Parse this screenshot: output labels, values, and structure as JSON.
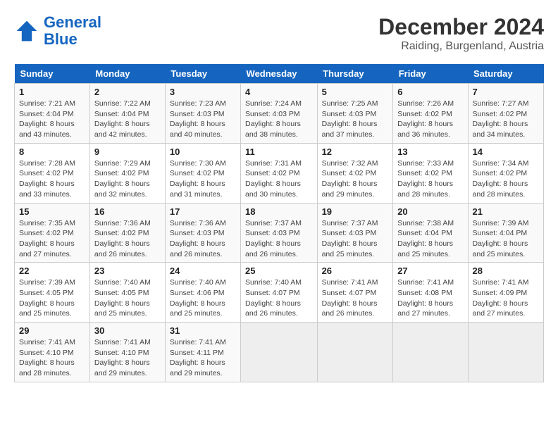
{
  "header": {
    "logo_line1": "General",
    "logo_line2": "Blue",
    "month_year": "December 2024",
    "location": "Raiding, Burgenland, Austria"
  },
  "days_of_week": [
    "Sunday",
    "Monday",
    "Tuesday",
    "Wednesday",
    "Thursday",
    "Friday",
    "Saturday"
  ],
  "weeks": [
    [
      {
        "day": "1",
        "info": "Sunrise: 7:21 AM\nSunset: 4:04 PM\nDaylight: 8 hours\nand 43 minutes."
      },
      {
        "day": "2",
        "info": "Sunrise: 7:22 AM\nSunset: 4:04 PM\nDaylight: 8 hours\nand 42 minutes."
      },
      {
        "day": "3",
        "info": "Sunrise: 7:23 AM\nSunset: 4:03 PM\nDaylight: 8 hours\nand 40 minutes."
      },
      {
        "day": "4",
        "info": "Sunrise: 7:24 AM\nSunset: 4:03 PM\nDaylight: 8 hours\nand 38 minutes."
      },
      {
        "day": "5",
        "info": "Sunrise: 7:25 AM\nSunset: 4:03 PM\nDaylight: 8 hours\nand 37 minutes."
      },
      {
        "day": "6",
        "info": "Sunrise: 7:26 AM\nSunset: 4:02 PM\nDaylight: 8 hours\nand 36 minutes."
      },
      {
        "day": "7",
        "info": "Sunrise: 7:27 AM\nSunset: 4:02 PM\nDaylight: 8 hours\nand 34 minutes."
      }
    ],
    [
      {
        "day": "8",
        "info": "Sunrise: 7:28 AM\nSunset: 4:02 PM\nDaylight: 8 hours\nand 33 minutes."
      },
      {
        "day": "9",
        "info": "Sunrise: 7:29 AM\nSunset: 4:02 PM\nDaylight: 8 hours\nand 32 minutes."
      },
      {
        "day": "10",
        "info": "Sunrise: 7:30 AM\nSunset: 4:02 PM\nDaylight: 8 hours\nand 31 minutes."
      },
      {
        "day": "11",
        "info": "Sunrise: 7:31 AM\nSunset: 4:02 PM\nDaylight: 8 hours\nand 30 minutes."
      },
      {
        "day": "12",
        "info": "Sunrise: 7:32 AM\nSunset: 4:02 PM\nDaylight: 8 hours\nand 29 minutes."
      },
      {
        "day": "13",
        "info": "Sunrise: 7:33 AM\nSunset: 4:02 PM\nDaylight: 8 hours\nand 28 minutes."
      },
      {
        "day": "14",
        "info": "Sunrise: 7:34 AM\nSunset: 4:02 PM\nDaylight: 8 hours\nand 28 minutes."
      }
    ],
    [
      {
        "day": "15",
        "info": "Sunrise: 7:35 AM\nSunset: 4:02 PM\nDaylight: 8 hours\nand 27 minutes."
      },
      {
        "day": "16",
        "info": "Sunrise: 7:36 AM\nSunset: 4:02 PM\nDaylight: 8 hours\nand 26 minutes."
      },
      {
        "day": "17",
        "info": "Sunrise: 7:36 AM\nSunset: 4:03 PM\nDaylight: 8 hours\nand 26 minutes."
      },
      {
        "day": "18",
        "info": "Sunrise: 7:37 AM\nSunset: 4:03 PM\nDaylight: 8 hours\nand 26 minutes."
      },
      {
        "day": "19",
        "info": "Sunrise: 7:37 AM\nSunset: 4:03 PM\nDaylight: 8 hours\nand 25 minutes."
      },
      {
        "day": "20",
        "info": "Sunrise: 7:38 AM\nSunset: 4:04 PM\nDaylight: 8 hours\nand 25 minutes."
      },
      {
        "day": "21",
        "info": "Sunrise: 7:39 AM\nSunset: 4:04 PM\nDaylight: 8 hours\nand 25 minutes."
      }
    ],
    [
      {
        "day": "22",
        "info": "Sunrise: 7:39 AM\nSunset: 4:05 PM\nDaylight: 8 hours\nand 25 minutes."
      },
      {
        "day": "23",
        "info": "Sunrise: 7:40 AM\nSunset: 4:05 PM\nDaylight: 8 hours\nand 25 minutes."
      },
      {
        "day": "24",
        "info": "Sunrise: 7:40 AM\nSunset: 4:06 PM\nDaylight: 8 hours\nand 25 minutes."
      },
      {
        "day": "25",
        "info": "Sunrise: 7:40 AM\nSunset: 4:07 PM\nDaylight: 8 hours\nand 26 minutes."
      },
      {
        "day": "26",
        "info": "Sunrise: 7:41 AM\nSunset: 4:07 PM\nDaylight: 8 hours\nand 26 minutes."
      },
      {
        "day": "27",
        "info": "Sunrise: 7:41 AM\nSunset: 4:08 PM\nDaylight: 8 hours\nand 27 minutes."
      },
      {
        "day": "28",
        "info": "Sunrise: 7:41 AM\nSunset: 4:09 PM\nDaylight: 8 hours\nand 27 minutes."
      }
    ],
    [
      {
        "day": "29",
        "info": "Sunrise: 7:41 AM\nSunset: 4:10 PM\nDaylight: 8 hours\nand 28 minutes."
      },
      {
        "day": "30",
        "info": "Sunrise: 7:41 AM\nSunset: 4:10 PM\nDaylight: 8 hours\nand 29 minutes."
      },
      {
        "day": "31",
        "info": "Sunrise: 7:41 AM\nSunset: 4:11 PM\nDaylight: 8 hours\nand 29 minutes."
      },
      {
        "day": "",
        "info": ""
      },
      {
        "day": "",
        "info": ""
      },
      {
        "day": "",
        "info": ""
      },
      {
        "day": "",
        "info": ""
      }
    ]
  ]
}
